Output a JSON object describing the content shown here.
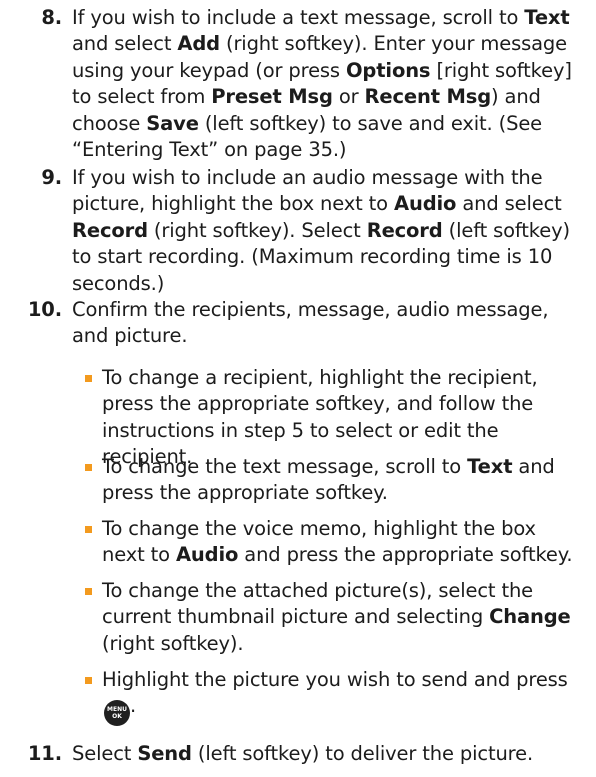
{
  "steps": [
    {
      "number": "8.",
      "parts": [
        "If you wish to include a text message, scroll to ",
        "Text",
        " and select ",
        "Add",
        " (right softkey). Enter your message using your keypad (or press ",
        "Options",
        " [right softkey] to select from ",
        "Preset Msg",
        " or ",
        "Recent Msg",
        ") and choose ",
        "Save",
        " (left softkey) to save and exit. (See “Entering Text” on page 35.)"
      ]
    },
    {
      "number": "9.",
      "parts": [
        "If you wish to include an audio message with the picture, highlight the box next to ",
        "Audio",
        " and select ",
        "Record",
        " (right softkey). Select ",
        "Record",
        " (left softkey) to start recording. (Maximum recording time is 10 seconds.)"
      ]
    },
    {
      "number": "10.",
      "parts": [
        "Confirm the recipients, message, audio message, and picture."
      ]
    },
    {
      "number": "11.",
      "parts": [
        "Select ",
        "Send",
        " (left softkey) to deliver the picture."
      ]
    }
  ],
  "bullets": [
    [
      "To change a recipient, highlight the recipient, press the appropriate softkey, and follow the instructions in step 5 to select or edit the recipient."
    ],
    [
      "To change the text message, scroll to ",
      "Text",
      " and press the appropriate softkey."
    ],
    [
      "To change the voice memo, highlight the box next to ",
      "Audio",
      " and press the appropriate softkey."
    ],
    [
      "To change the attached picture(s), select the current thumbnail picture and selecting ",
      "Change",
      " (right softkey)."
    ],
    [
      "Highlight the picture you wish to send and press ",
      "."
    ]
  ],
  "menu_key": {
    "icon": "menu-ok-key-icon",
    "line1": "MENU",
    "line2": "OK",
    "colors": {
      "key": "#202020",
      "bullet": "#f39a1e"
    }
  }
}
